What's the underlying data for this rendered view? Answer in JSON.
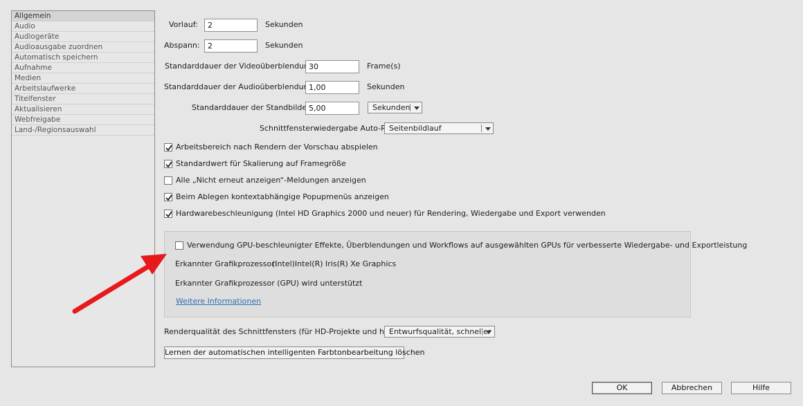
{
  "sidebar": {
    "items": [
      "Allgemein",
      "Audio",
      "Audiogeräte",
      "Audioausgabe zuordnen",
      "Automatisch speichern",
      "Aufnahme",
      "Medien",
      "Arbeitslaufwerke",
      "Titelfenster",
      "Aktualisieren",
      "Webfreigabe",
      "Land-/Regionsauswahl"
    ],
    "selected_index": 0
  },
  "general": {
    "preroll": {
      "label": "Vorlauf:",
      "value": "2",
      "unit": "Sekunden"
    },
    "postroll": {
      "label": "Abspann:",
      "value": "2",
      "unit": "Sekunden"
    },
    "video_transition": {
      "label": "Standarddauer der Videoüberblendung:",
      "value": "30",
      "unit": "Frame(s)"
    },
    "audio_transition": {
      "label": "Standarddauer der Audioüberblendung:",
      "value": "1,00",
      "unit": "Sekunden"
    },
    "still_image": {
      "label": "Standarddauer der Standbilder:",
      "value": "5,00",
      "unit_dropdown": "Sekunden"
    },
    "autoscroll": {
      "label": "Schnittfensterwiedergabe Auto-Rollen:",
      "value": "Seitenbildlauf"
    }
  },
  "checkboxes": [
    {
      "label": "Arbeitsbereich nach Rendern der Vorschau abspielen",
      "checked": true
    },
    {
      "label": "Standardwert für Skalierung auf Framegröße",
      "checked": true
    },
    {
      "label": "Alle „Nicht erneut anzeigen“-Meldungen anzeigen",
      "checked": false
    },
    {
      "label": "Beim Ablegen kontextabhängige Popupmenüs anzeigen",
      "checked": true
    },
    {
      "label": "Hardwarebeschleunigung (Intel HD Graphics 2000 und neuer) für Rendering, Wiedergabe und Export verwenden",
      "checked": true
    }
  ],
  "gpu": {
    "checkbox_label": "Verwendung GPU-beschleunigter Effekte, Überblendungen und Workflows auf ausgewählten GPUs für verbesserte Wiedergabe- und Exportleistung",
    "checked": false,
    "detected_label": "Erkannter Grafikprozessor:",
    "detected_value": "(Intel)Intel(R) Iris(R) Xe Graphics",
    "supported_text": "Erkannter Grafikprozessor (GPU) wird unterstützt",
    "more_info": "Weitere Informationen"
  },
  "render_quality": {
    "label": "Renderqualität des Schnittfensters (für HD-Projekte und höher):",
    "value": "Entwurfsqualität, schneller"
  },
  "reset_button": "Lernen der automatischen intelligenten Farbtonbearbeitung löschen",
  "footer": {
    "ok": "OK",
    "cancel": "Abbrechen",
    "help": "Hilfe"
  },
  "colors": {
    "annotation_arrow": "#e8191b",
    "link": "#2e6fb5",
    "background": "#e6e6e6"
  }
}
